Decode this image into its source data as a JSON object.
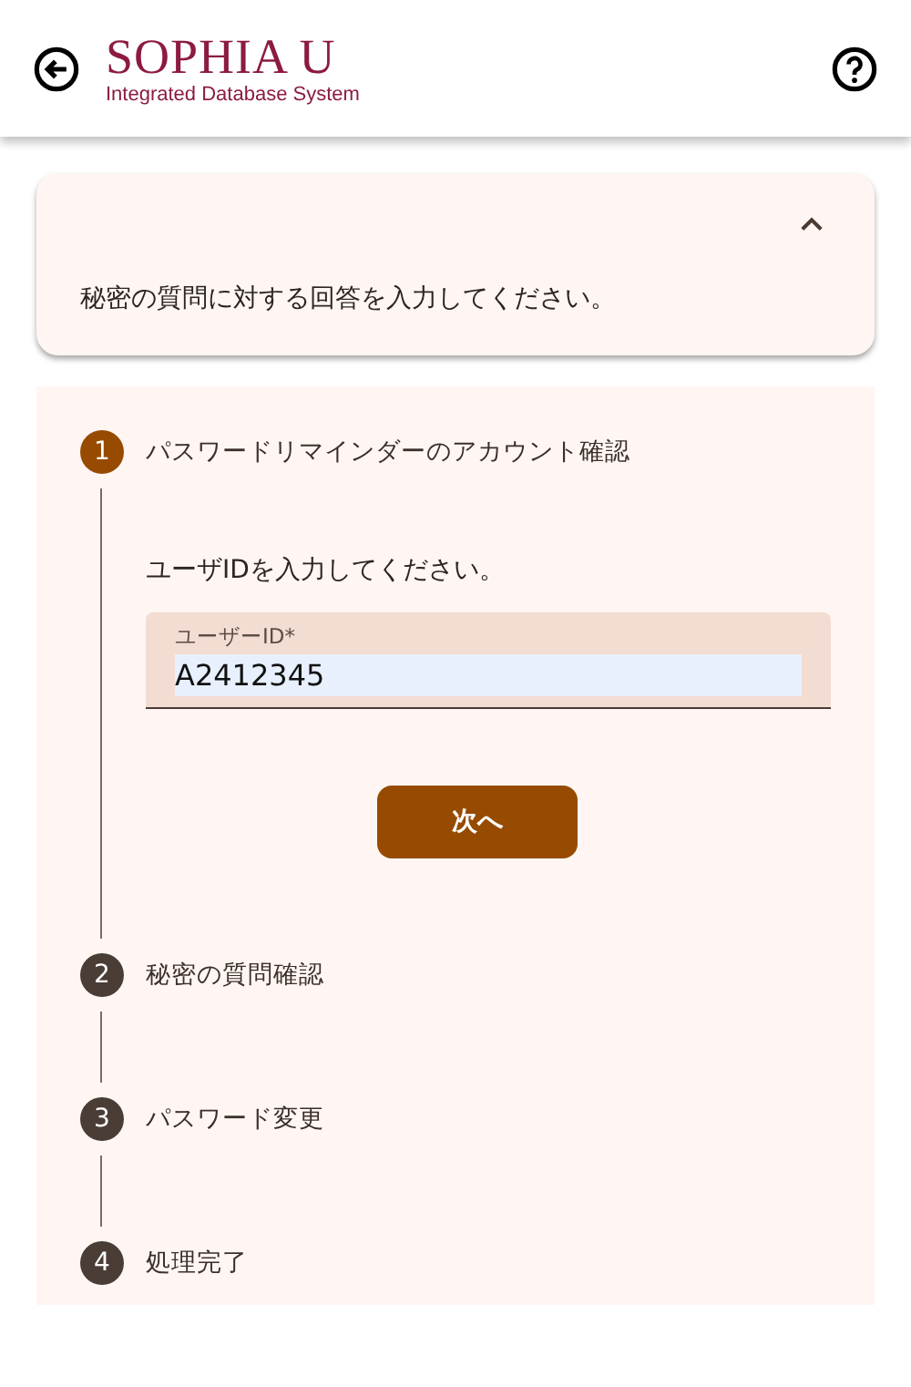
{
  "header": {
    "logo_title": "SOPHIA U",
    "logo_subtitle": "Integrated Database System"
  },
  "info_card": {
    "expanded": true,
    "message": "秘密の質問に対する回答を入力してください。"
  },
  "steps": [
    {
      "number": "1",
      "label": "パスワードリマインダーのアカウント確認",
      "selected": true,
      "instruction": "ユーザIDを入力してください。",
      "field_label": "ユーザーID*",
      "field_value": "A2412345",
      "button": "次へ"
    },
    {
      "number": "2",
      "label": "秘密の質問確認",
      "selected": false
    },
    {
      "number": "3",
      "label": "パスワード変更",
      "selected": false
    },
    {
      "number": "4",
      "label": "処理完了",
      "selected": false
    }
  ]
}
